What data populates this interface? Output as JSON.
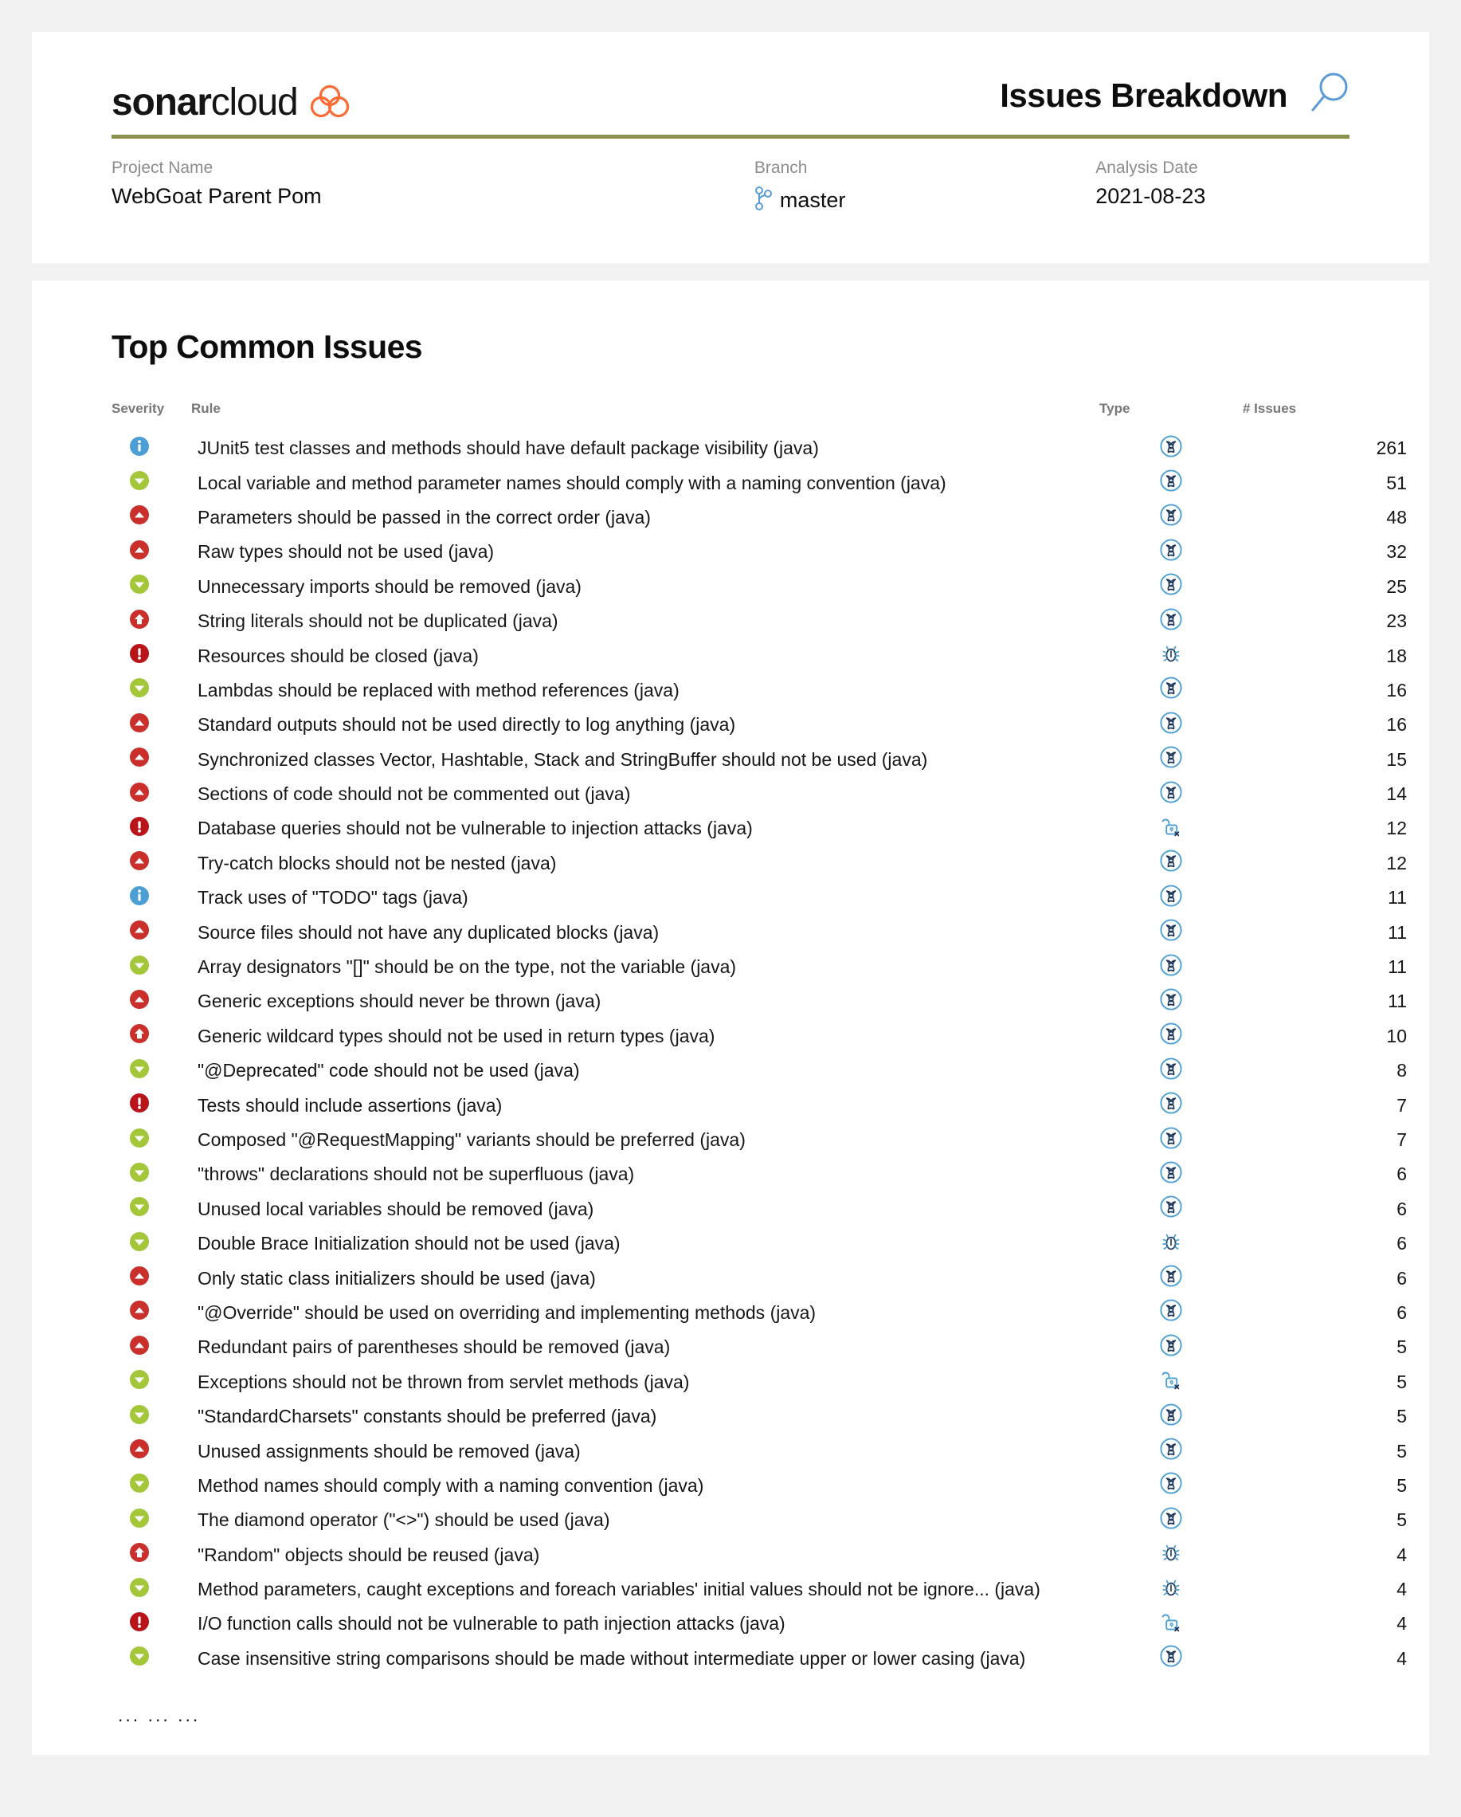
{
  "brand": {
    "logo_bold": "sonar",
    "logo_light": "cloud",
    "logo_icon": "sonarcloud-cloud-icon",
    "logo_color": "#fd6a33"
  },
  "header": {
    "report_title": "Issues Breakdown",
    "report_icon": "magnifier-icon",
    "rule_color": "#8c9150",
    "accent_blue": "#4a90d9"
  },
  "meta": {
    "project": {
      "label": "Project Name",
      "value": "WebGoat Parent Pom"
    },
    "branch": {
      "label": "Branch",
      "value": "master",
      "icon": "git-branch-icon"
    },
    "date": {
      "label": "Analysis Date",
      "value": "2021-08-23"
    }
  },
  "section": {
    "title": "Top Common Issues",
    "columns": {
      "severity": "Severity",
      "rule": "Rule",
      "type": "Type",
      "count": "# Issues"
    },
    "footer_ellipsis": "... ... ..."
  },
  "legend": {
    "severity_icons": {
      "info": {
        "name": "severity-info-icon",
        "color": "#4b9fd5",
        "glyph": "i"
      },
      "minor": {
        "name": "severity-minor-icon",
        "color": "#a4c639",
        "glyph": "chevron-down"
      },
      "major": {
        "name": "severity-major-icon",
        "color": "#c9302c",
        "glyph": "arrow-up"
      },
      "critical": {
        "name": "severity-critical-icon",
        "color": "#c9302c",
        "glyph": "chevron-up"
      },
      "blocker": {
        "name": "severity-blocker-icon",
        "color": "#b9141a",
        "glyph": "exclamation"
      }
    },
    "type_icons": {
      "code_smell": {
        "name": "code-smell-icon",
        "color": "#4b9fd5"
      },
      "bug": {
        "name": "bug-icon",
        "color": "#4b9fd5"
      },
      "vulnerability": {
        "name": "vulnerability-icon",
        "color": "#4b9fd5"
      }
    }
  },
  "rows": [
    {
      "severity": "info",
      "rule": "JUnit5 test classes and methods should have default package visibility (java)",
      "type": "code_smell",
      "count": "261"
    },
    {
      "severity": "minor",
      "rule": "Local variable and method parameter names should comply with a naming convention (java)",
      "type": "code_smell",
      "count": "51"
    },
    {
      "severity": "critical",
      "rule": "Parameters should be passed in the correct order (java)",
      "type": "code_smell",
      "count": "48"
    },
    {
      "severity": "critical",
      "rule": "Raw types should not be used (java)",
      "type": "code_smell",
      "count": "32"
    },
    {
      "severity": "minor",
      "rule": "Unnecessary imports should be removed (java)",
      "type": "code_smell",
      "count": "25"
    },
    {
      "severity": "major",
      "rule": "String literals should not be duplicated (java)",
      "type": "code_smell",
      "count": "23"
    },
    {
      "severity": "blocker",
      "rule": "Resources should be closed (java)",
      "type": "bug",
      "count": "18"
    },
    {
      "severity": "minor",
      "rule": "Lambdas should be replaced with method references (java)",
      "type": "code_smell",
      "count": "16"
    },
    {
      "severity": "critical",
      "rule": "Standard outputs should not be used directly to log anything (java)",
      "type": "code_smell",
      "count": "16"
    },
    {
      "severity": "critical",
      "rule": "Synchronized classes Vector, Hashtable, Stack and StringBuffer should not be used (java)",
      "type": "code_smell",
      "count": "15"
    },
    {
      "severity": "critical",
      "rule": "Sections of code should not be commented out (java)",
      "type": "code_smell",
      "count": "14"
    },
    {
      "severity": "blocker",
      "rule": "Database queries should not be vulnerable to injection attacks (java)",
      "type": "vulnerability",
      "count": "12"
    },
    {
      "severity": "critical",
      "rule": "Try-catch blocks should not be nested (java)",
      "type": "code_smell",
      "count": "12"
    },
    {
      "severity": "info",
      "rule": "Track uses of \"TODO\" tags (java)",
      "type": "code_smell",
      "count": "11"
    },
    {
      "severity": "critical",
      "rule": "Source files should not have any duplicated blocks (java)",
      "type": "code_smell",
      "count": "11"
    },
    {
      "severity": "minor",
      "rule": "Array designators \"[]\" should be on the type, not the variable (java)",
      "type": "code_smell",
      "count": "11"
    },
    {
      "severity": "critical",
      "rule": "Generic exceptions should never be thrown (java)",
      "type": "code_smell",
      "count": "11"
    },
    {
      "severity": "major",
      "rule": "Generic wildcard types should not be used in return types (java)",
      "type": "code_smell",
      "count": "10"
    },
    {
      "severity": "minor",
      "rule": "\"@Deprecated\" code should not be used (java)",
      "type": "code_smell",
      "count": "8"
    },
    {
      "severity": "blocker",
      "rule": "Tests should include assertions (java)",
      "type": "code_smell",
      "count": "7"
    },
    {
      "severity": "minor",
      "rule": "Composed \"@RequestMapping\" variants should be preferred (java)",
      "type": "code_smell",
      "count": "7"
    },
    {
      "severity": "minor",
      "rule": "\"throws\" declarations should not be superfluous (java)",
      "type": "code_smell",
      "count": "6"
    },
    {
      "severity": "minor",
      "rule": "Unused local variables should be removed (java)",
      "type": "code_smell",
      "count": "6"
    },
    {
      "severity": "minor",
      "rule": "Double Brace Initialization should not be used (java)",
      "type": "bug",
      "count": "6"
    },
    {
      "severity": "critical",
      "rule": "Only static class initializers should be used (java)",
      "type": "code_smell",
      "count": "6"
    },
    {
      "severity": "critical",
      "rule": "\"@Override\" should be used on overriding and implementing methods (java)",
      "type": "code_smell",
      "count": "6"
    },
    {
      "severity": "critical",
      "rule": "Redundant pairs of parentheses should be removed (java)",
      "type": "code_smell",
      "count": "5"
    },
    {
      "severity": "minor",
      "rule": "Exceptions should not be thrown from servlet methods (java)",
      "type": "vulnerability",
      "count": "5"
    },
    {
      "severity": "minor",
      "rule": "\"StandardCharsets\" constants should be preferred (java)",
      "type": "code_smell",
      "count": "5"
    },
    {
      "severity": "critical",
      "rule": "Unused assignments should be removed (java)",
      "type": "code_smell",
      "count": "5"
    },
    {
      "severity": "minor",
      "rule": "Method names should comply with a naming convention (java)",
      "type": "code_smell",
      "count": "5"
    },
    {
      "severity": "minor",
      "rule": "The diamond operator (\"<>\") should be used (java)",
      "type": "code_smell",
      "count": "5"
    },
    {
      "severity": "major",
      "rule": "\"Random\" objects should be reused (java)",
      "type": "bug",
      "count": "4"
    },
    {
      "severity": "minor",
      "rule": "Method parameters, caught exceptions and foreach variables' initial values should not be ignore... (java)",
      "type": "bug",
      "count": "4"
    },
    {
      "severity": "blocker",
      "rule": "I/O function calls should not be vulnerable to path injection attacks (java)",
      "type": "vulnerability",
      "count": "4"
    },
    {
      "severity": "minor",
      "rule": "Case insensitive string comparisons should be made without intermediate upper or lower casing (java)",
      "type": "code_smell",
      "count": "4"
    }
  ]
}
